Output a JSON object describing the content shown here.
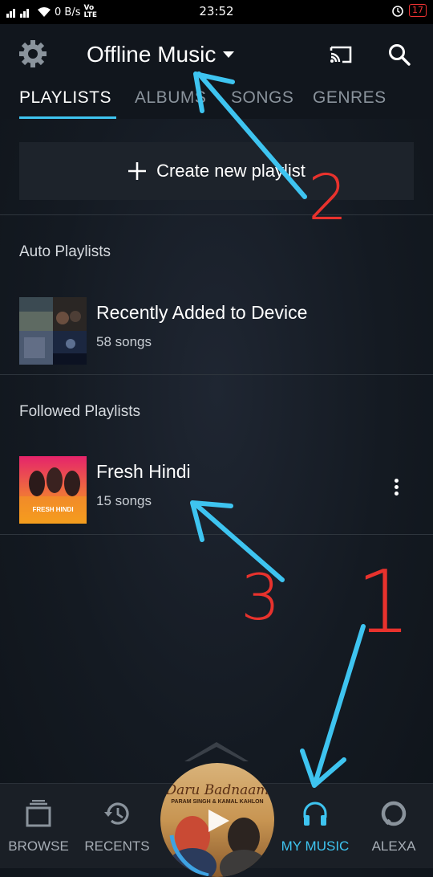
{
  "status_bar": {
    "network_left": "4G 3G",
    "data_rate": "0 B/s",
    "volte": "Vo LTE",
    "time": "23:52",
    "battery": "17"
  },
  "header": {
    "title": "Offline Music",
    "icons": [
      "gear-icon",
      "chevron-down-icon",
      "cast-icon",
      "search-icon"
    ]
  },
  "tabs": [
    {
      "label": "PLAYLISTS",
      "active": true
    },
    {
      "label": "ALBUMS",
      "active": false
    },
    {
      "label": "SONGS",
      "active": false
    },
    {
      "label": "GENRES",
      "active": false
    }
  ],
  "create_playlist": {
    "label": "Create new playlist"
  },
  "auto_playlists": {
    "title": "Auto Playlists",
    "items": [
      {
        "title": "Recently Added to Device",
        "subtitle": "58 songs"
      }
    ]
  },
  "followed_playlists": {
    "title": "Followed Playlists",
    "items": [
      {
        "title": "Fresh Hindi",
        "subtitle": "15 songs",
        "thumb_text": "FRESH HINDI"
      }
    ]
  },
  "bottom_nav": [
    {
      "label": "BROWSE",
      "icon": "browse-icon",
      "active": false
    },
    {
      "label": "RECENTS",
      "icon": "history-icon",
      "active": false
    },
    {
      "label": "MY MUSIC",
      "icon": "headphones-icon",
      "active": true
    },
    {
      "label": "ALEXA",
      "icon": "alexa-icon",
      "active": false
    }
  ],
  "now_playing": {
    "title": "Daru Badnaam",
    "artists": "PARAM SINGH & KAMAL KAHLON"
  },
  "annotations": [
    "1",
    "2",
    "3"
  ],
  "colors": {
    "accent": "#3ec4f0",
    "annotation_arrow": "#3ec4f0",
    "annotation_number": "#e8322d",
    "background": "#141a22"
  }
}
